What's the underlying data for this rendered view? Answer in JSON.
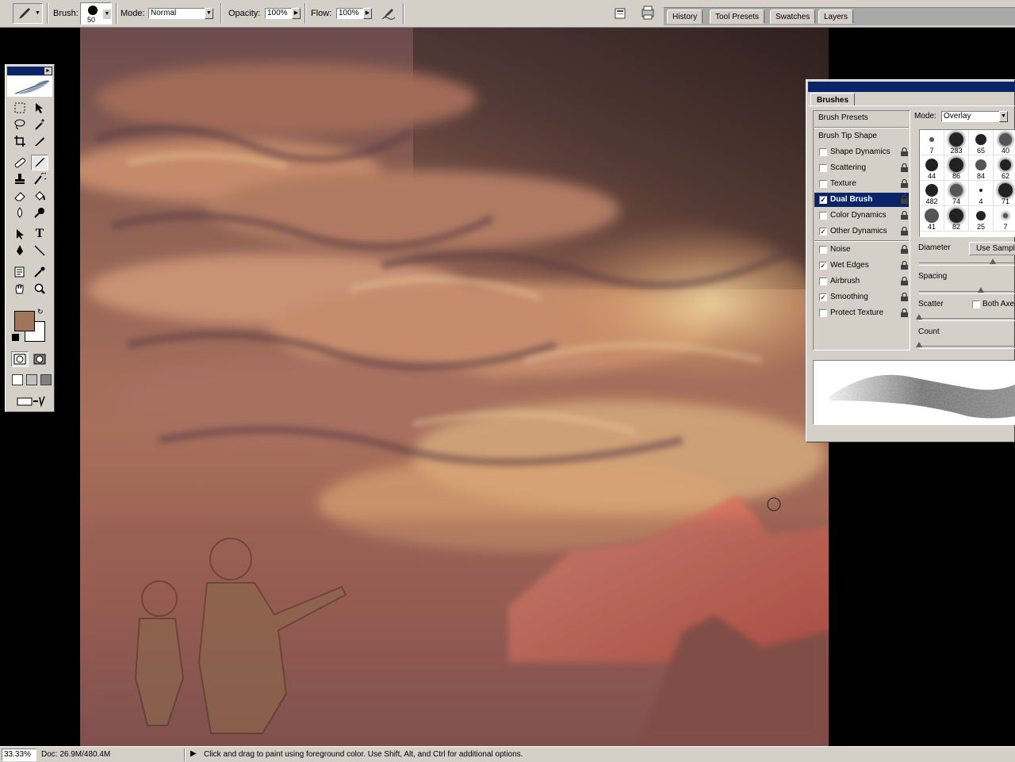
{
  "options_bar": {
    "brush_label": "Brush:",
    "brush_size": "50",
    "mode_label": "Mode:",
    "mode_value": "Normal",
    "opacity_label": "Opacity:",
    "opacity_value": "100%",
    "flow_label": "Flow:",
    "flow_value": "100%"
  },
  "palette_well": {
    "tabs": [
      "History",
      "Tool Presets",
      "Swatches",
      "Layers"
    ]
  },
  "toolbox": {
    "foreground_color": "#a0755a",
    "background_color": "#ffffff"
  },
  "brushes_panel": {
    "tab_label": "Brushes",
    "list": [
      {
        "label": "Brush Presets",
        "checkbox": false,
        "checked": false,
        "selected": false,
        "lock": false
      },
      {
        "label": "Brush Tip Shape",
        "checkbox": false,
        "checked": false,
        "selected": false,
        "lock": false
      },
      {
        "label": "Shape Dynamics",
        "checkbox": true,
        "checked": false,
        "selected": false,
        "lock": true
      },
      {
        "label": "Scattering",
        "checkbox": true,
        "checked": false,
        "selected": false,
        "lock": true
      },
      {
        "label": "Texture",
        "checkbox": true,
        "checked": false,
        "selected": false,
        "lock": true
      },
      {
        "label": "Dual Brush",
        "checkbox": true,
        "checked": true,
        "selected": true,
        "lock": true
      },
      {
        "label": "Color Dynamics",
        "checkbox": true,
        "checked": false,
        "selected": false,
        "lock": true
      },
      {
        "label": "Other Dynamics",
        "checkbox": true,
        "checked": true,
        "selected": false,
        "lock": true
      },
      {
        "label": "Noise",
        "checkbox": true,
        "checked": false,
        "selected": false,
        "lock": true
      },
      {
        "label": "Wet Edges",
        "checkbox": true,
        "checked": true,
        "selected": false,
        "lock": true
      },
      {
        "label": "Airbrush",
        "checkbox": true,
        "checked": false,
        "selected": false,
        "lock": true
      },
      {
        "label": "Smoothing",
        "checkbox": true,
        "checked": true,
        "selected": false,
        "lock": true
      },
      {
        "label": "Protect Texture",
        "checkbox": true,
        "checked": false,
        "selected": false,
        "lock": true
      }
    ],
    "mode_label": "Mode:",
    "mode_value": "Overlay",
    "tips": [
      "7",
      "283",
      "65",
      "40",
      "44",
      "86",
      "84",
      "62",
      "482",
      "74",
      "4",
      "71",
      "41",
      "82",
      "25",
      "7"
    ],
    "diameter_label": "Diameter",
    "use_sample_label": "Use Sample",
    "spacing_label": "Spacing",
    "scatter_label": "Scatter",
    "both_axes_label": "Both Axe",
    "count_label": "Count"
  },
  "status_bar": {
    "zoom": "33.33%",
    "doc": "Doc: 26.9M/480.4M",
    "hint": "Click and drag to paint using foreground color.  Use Shift, Alt, and Ctrl for additional options."
  }
}
